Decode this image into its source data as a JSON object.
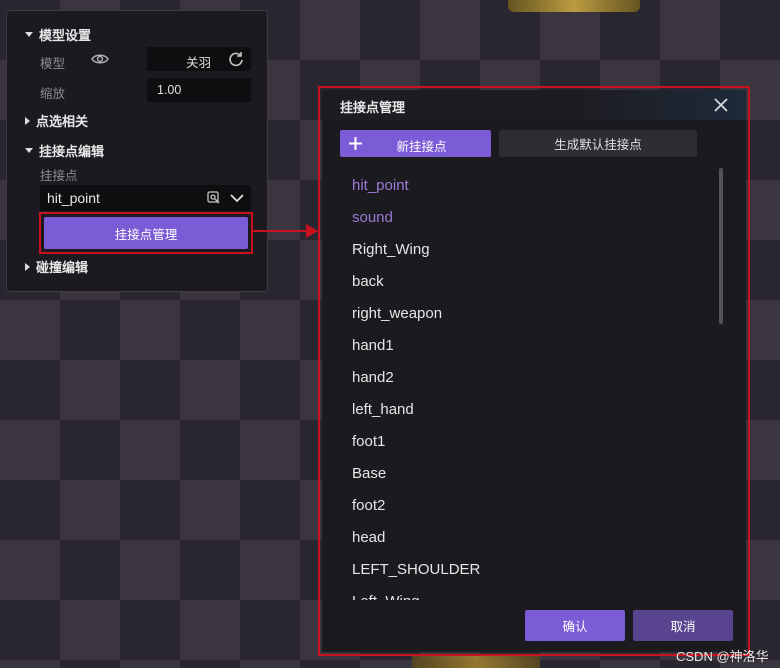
{
  "left_panel": {
    "model_settings": {
      "header": "模型设置",
      "model_label": "模型",
      "model_value": "关羽",
      "scale_label": "缩放",
      "scale_value": "1.00"
    },
    "pick_header": "点选相关",
    "attach_edit": {
      "header": "挂接点编辑",
      "attach_label": "挂接点",
      "selected": "hit_point",
      "manage_button": "挂接点管理"
    },
    "collision_header": "碰撞编辑"
  },
  "dialog": {
    "title": "挂接点管理",
    "new_button": "新挂接点",
    "generate_button": "生成默认挂接点",
    "items": [
      {
        "label": "hit_point",
        "color": "#9b7ad6"
      },
      {
        "label": "sound",
        "color": "#9b7ad6"
      },
      {
        "label": "Right_Wing"
      },
      {
        "label": "back"
      },
      {
        "label": "right_weapon"
      },
      {
        "label": "hand1"
      },
      {
        "label": "hand2"
      },
      {
        "label": "left_hand"
      },
      {
        "label": "foot1"
      },
      {
        "label": "Base"
      },
      {
        "label": "foot2"
      },
      {
        "label": "head"
      },
      {
        "label": "LEFT_SHOULDER"
      },
      {
        "label": "Left_Wing"
      }
    ],
    "ok_button": "确认",
    "cancel_button": "取消"
  },
  "colors": {
    "accent": "#7b5bd6",
    "highlight_red": "#c8121f",
    "panel_bg": "#1b1a1e"
  },
  "watermark": "CSDN @神洛华"
}
